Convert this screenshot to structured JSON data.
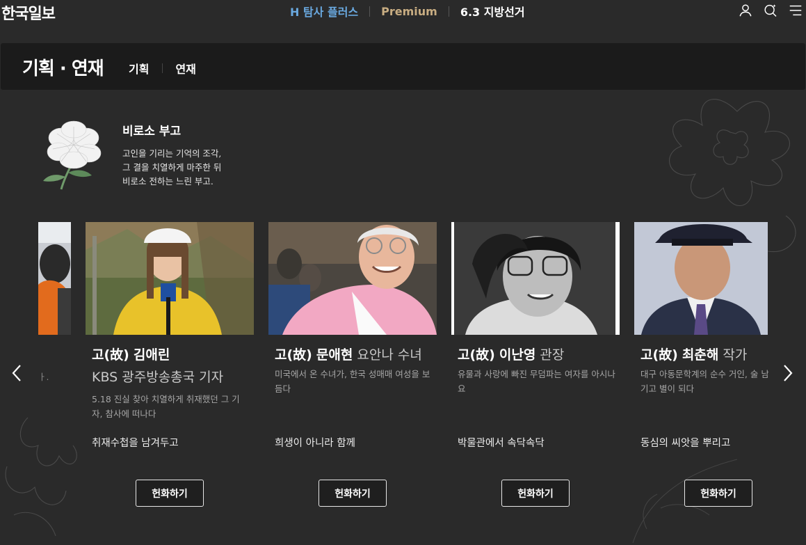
{
  "site": {
    "logo": "한국일보"
  },
  "topnav": {
    "items": [
      {
        "label": "H 탐사 플러스",
        "color": "#6aa9e0"
      },
      {
        "label": "Premium",
        "color": "#c8ad82"
      },
      {
        "label": "6.3 지방선거",
        "color": "#ffffff"
      }
    ],
    "icons": [
      "user-icon",
      "search-icon",
      "menu-icon"
    ]
  },
  "section": {
    "title": "기획 · 연재",
    "tabs": [
      "기획",
      "연재"
    ]
  },
  "intro": {
    "title": "비로소 부고",
    "description": "고인을 기리는 기억의 조각,\n그 결을 치열하게 마주한 뒤\n비로소 전하는 느린 부고."
  },
  "carousel": {
    "partial_text": "ㅏ.",
    "cards": [
      {
        "name_prefix": "고(故)",
        "name": "김애린",
        "role": "",
        "role_line2": "KBS 광주방송총국 기자",
        "description": "5.18 진실 찾아 치열하게 취재했던 그 기자, 참사에 떠나다",
        "quote": "취재수첩을 남겨두고",
        "button": "헌화하기"
      },
      {
        "name_prefix": "고(故)",
        "name": "문애현",
        "role": "요안나 수녀",
        "role_line2": "",
        "description": "미국에서 온 수녀가, 한국 성매매 여성을 보듬다",
        "quote": "희생이 아니라 함께",
        "button": "헌화하기"
      },
      {
        "name_prefix": "고(故)",
        "name": "이난영",
        "role": "관장",
        "role_line2": "",
        "description": "유물과 사랑에 빠진 무덤파는 여자를 아시나요",
        "quote": "박물관에서 속닥속닥",
        "button": "헌화하기"
      },
      {
        "name_prefix": "고(故)",
        "name": "최춘해",
        "role": "작가",
        "role_line2": "",
        "description": "대구 아동문학계의 순수 거인, 술 남기고 별이 되다",
        "quote": "동심의 씨앗을 뿌리고",
        "button": "헌화하기"
      }
    ]
  },
  "colors": {
    "background": "#2a2a2a",
    "header_bar": "#1b1b1b",
    "accent_blue": "#6aa9e0",
    "accent_gold": "#c8ad82"
  }
}
